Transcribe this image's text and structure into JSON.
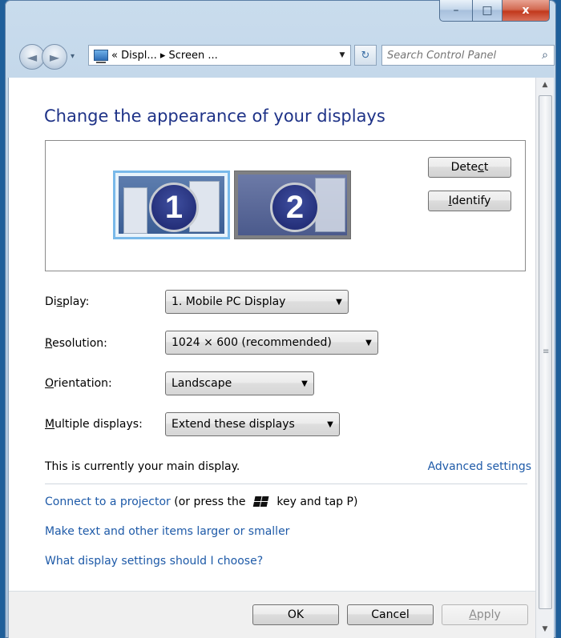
{
  "window": {
    "controls": {
      "minimize": "–",
      "maximize": "□",
      "close": "x"
    }
  },
  "nav": {
    "back_glyph": "◄",
    "forward_glyph": "►",
    "address_text": "« Displ... ▸ Screen ...",
    "search_placeholder": "Search Control Panel"
  },
  "page": {
    "title": "Change the appearance of your displays"
  },
  "monitors": [
    {
      "number": "1",
      "selected": true
    },
    {
      "number": "2",
      "selected": false
    }
  ],
  "buttons": {
    "detect": {
      "before": "Dete",
      "mnemonic": "c",
      "after": "t"
    },
    "identify": {
      "before": "",
      "mnemonic": "I",
      "after": "dentify"
    }
  },
  "settings": {
    "display": {
      "label_before": "Di",
      "label_mnemonic": "s",
      "label_after": "play:",
      "value": "1. Mobile PC Display"
    },
    "resolution": {
      "label_before": "",
      "label_mnemonic": "R",
      "label_after": "esolution:",
      "value": "1024 × 600 (recommended)"
    },
    "orientation": {
      "label_before": "",
      "label_mnemonic": "O",
      "label_after": "rientation:",
      "value": "Landscape"
    },
    "multiple": {
      "label_before": "",
      "label_mnemonic": "M",
      "label_after": "ultiple displays:",
      "value": "Extend these displays"
    }
  },
  "status": {
    "main_display_text": "This is currently your main display.",
    "advanced_link": "Advanced settings"
  },
  "links": {
    "projector_link": "Connect to a projector",
    "projector_before_key": " (or press the ",
    "projector_after_key": " key and tap P)",
    "text_size": "Make text and other items larger or smaller",
    "which_settings": "What display settings should I choose?"
  },
  "footer": {
    "ok": "OK",
    "cancel": "Cancel",
    "apply_mnemonic": "A",
    "apply_rest": "pply"
  },
  "scrollbar": {
    "up": "▲",
    "down": "▼",
    "grip": "≡"
  }
}
